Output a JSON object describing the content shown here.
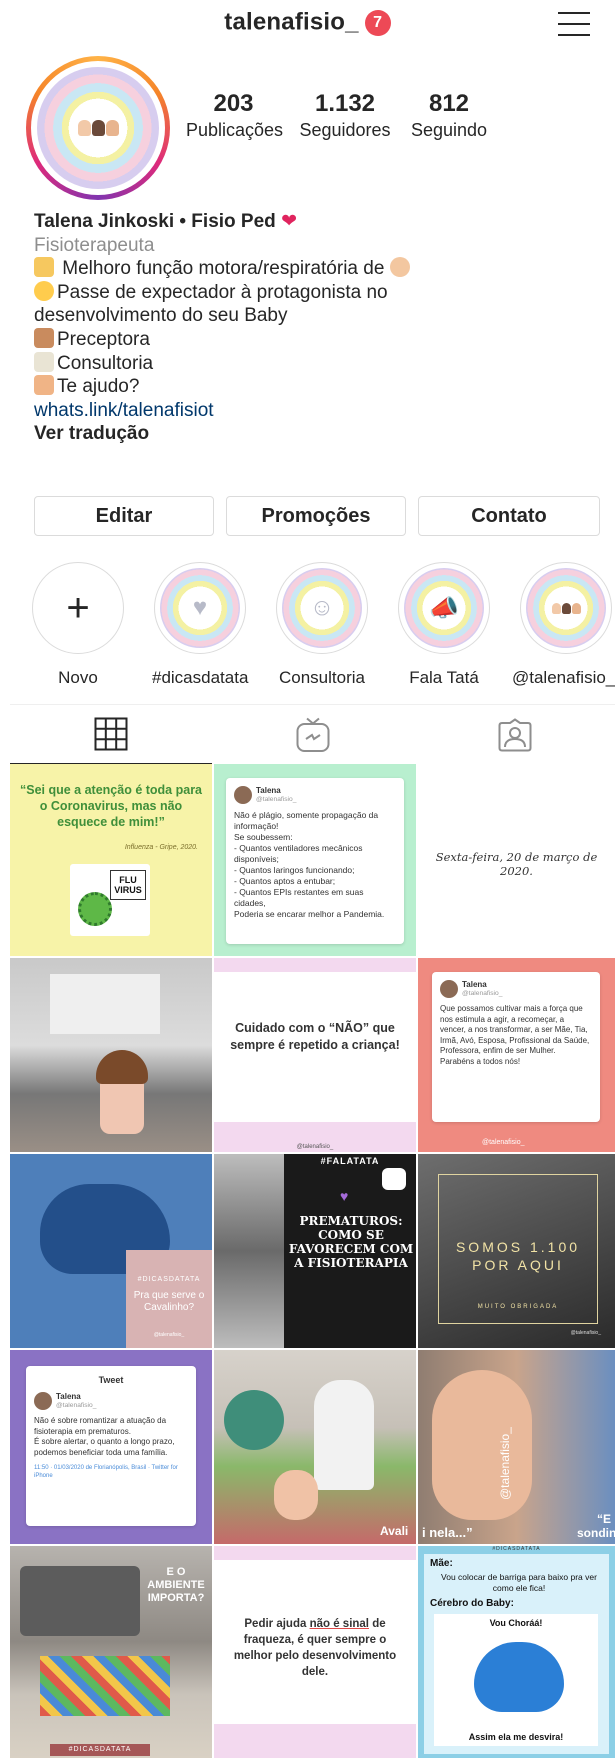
{
  "header": {
    "username": "talenafisio_",
    "notification_count": "7"
  },
  "profile": {
    "stats": [
      {
        "value": "203",
        "label": "Publicações"
      },
      {
        "value": "1.132",
        "label": "Seguidores"
      },
      {
        "value": "812",
        "label": "Seguindo"
      }
    ],
    "name": "Talena Jinkoski • Fisio Ped",
    "category": "Fisioterapeuta",
    "bio_lines": [
      "Melhoro função motora/respiratória de",
      "Passe de expectador à protagonista no",
      "desenvolvimento do seu Baby",
      "Preceptora",
      "Consultoria",
      "Te ajudo?"
    ],
    "link": "whats.link/talenafisiot",
    "translate": "Ver tradução"
  },
  "buttons": {
    "edit": "Editar",
    "promotions": "Promoções",
    "contact": "Contato"
  },
  "highlights": [
    {
      "label": "Novo",
      "icon": "plus-icon"
    },
    {
      "label": "#dicasdatata",
      "icon": "heart-icon"
    },
    {
      "label": "Consultoria",
      "icon": "smile-icon"
    },
    {
      "label": "Fala Tatá",
      "icon": "megaphone-icon"
    },
    {
      "label": "@talenafisio_",
      "icon": "kids-icon"
    }
  ],
  "tabs": [
    {
      "icon": "grid-icon"
    },
    {
      "icon": "igtv-icon"
    },
    {
      "icon": "tagged-icon"
    }
  ],
  "posts": {
    "p1": {
      "quote": "“Sei que a atenção é toda para o Coronavirus, mas não esquece de mim!”",
      "source": "Influenza - Gripe, 2020.",
      "sign": "FLU VIRUS"
    },
    "p2": {
      "author": "Talena",
      "handle": "@talenafisio_",
      "text": "Não é plágio, somente propagação da informação!\nSe soubessem:\n- Quantos ventiladores mecânicos disponíveis;\n- Quantos laringos funcionando;\n- Quantos aptos a entubar;\n- Quantos EPIs restantes em suas cidades,\nPoderia se encarar melhor a Pandemia."
    },
    "p3": {
      "text": "Sexta-feira, 20 de março de 2020."
    },
    "p5": {
      "text": "Cuidado com o “NÃO” que sempre é repetido a criança!",
      "footer": "@talenafisio_"
    },
    "p6": {
      "author": "Talena",
      "handle": "@talenafisio_",
      "text": "Que possamos cultivar mais a força que nos estimula a agir, a recomeçar, a vencer, a nos transformar, a ser Mãe, Tia, Irmã, Avó, Esposa, Profissional da Saúde, Professora, enfim de ser Mulher.\nParabéns a todos nós!",
      "footer": "@talenafisio_"
    },
    "p7": {
      "tag": "#DICASDATATA",
      "text": "Pra que serve o Cavalinho?",
      "footer": "@talenafisio_"
    },
    "p8": {
      "tag": "#FALATATA",
      "text": "PREMATUROS: COMO SE FAVORECEM COM A FISIOTERAPIA"
    },
    "p9": {
      "text": "SOMOS 1.100 POR AQUI",
      "sub": "MUITO OBRIGADA",
      "footer": "@talenafisio_"
    },
    "p10": {
      "title": "Tweet",
      "author": "Talena",
      "handle": "@talenafisio_",
      "text": "Não é sobre romantizar a atuação da fisioterapia em prematuros.\nÉ sobre alertar, o quanto a longo prazo, podemos beneficiar toda uma família.",
      "meta": "11:50 · 01/03/2020 de Florianópolis, Brasil · Twitter for iPhone"
    },
    "p11": {
      "caption": "Avali"
    },
    "p12": {
      "caption": "i nela...”",
      "side": "@talenafisio_",
      "right": "“E sondin"
    },
    "p13": {
      "text": "E O AMBIENTE IMPORTA?",
      "tag": "#DICASDATATA"
    },
    "p14": {
      "text_a": "Pedir ajuda ",
      "text_b": "não é sinal",
      "text_c": " de fraqueza, é quer sempre o melhor pelo desenvolvimento dele."
    },
    "p15": {
      "tag": "#DICASDATATA",
      "l1": "Mãe:",
      "l2": "Vou colocar de barriga para baixo pra ver como ele fica!",
      "l3": "Cérebro do Baby:",
      "l4": "Vou Choráá!",
      "l5": "Assim ela me desvira!"
    }
  }
}
